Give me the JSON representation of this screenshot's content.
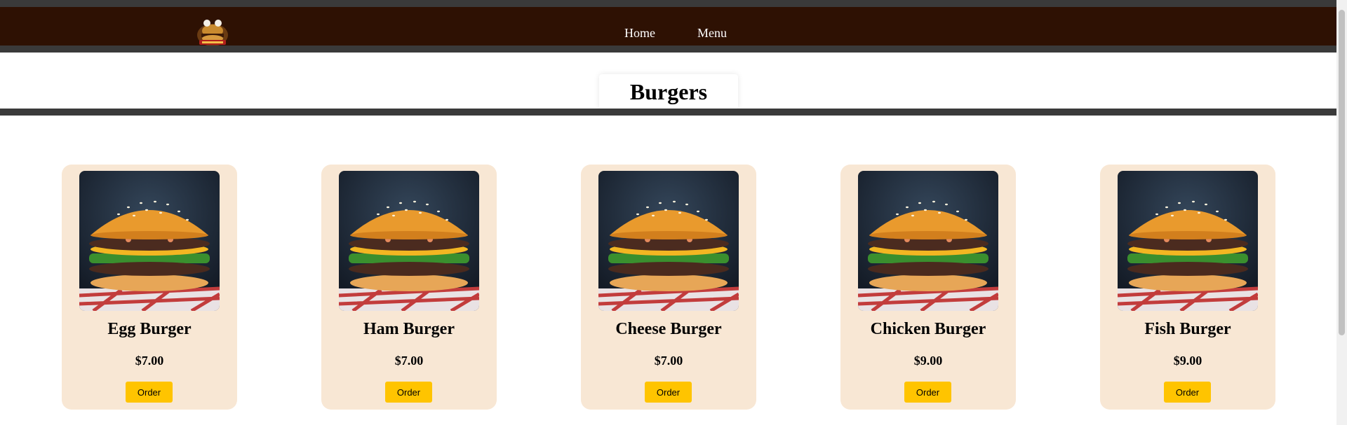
{
  "nav": {
    "logo_icon": "burger-logo-icon",
    "home_label": "Home",
    "menu_label": "Menu"
  },
  "page": {
    "title": "Burgers"
  },
  "products": [
    {
      "name": "Egg Burger",
      "price": "$7.00",
      "order_label": "Order",
      "image_icon": "burger-photo"
    },
    {
      "name": "Ham Burger",
      "price": "$7.00",
      "order_label": "Order",
      "image_icon": "burger-photo"
    },
    {
      "name": "Cheese Burger",
      "price": "$7.00",
      "order_label": "Order",
      "image_icon": "burger-photo"
    },
    {
      "name": "Chicken Burger",
      "price": "$9.00",
      "order_label": "Order",
      "image_icon": "burger-photo"
    },
    {
      "name": "Fish Burger",
      "price": "$9.00",
      "order_label": "Order",
      "image_icon": "burger-photo"
    }
  ],
  "colors": {
    "navbar_bg": "#2e1103",
    "strip": "#3a3a3a",
    "card_bg": "#f8e7d4",
    "order_button": "#ffc400"
  }
}
